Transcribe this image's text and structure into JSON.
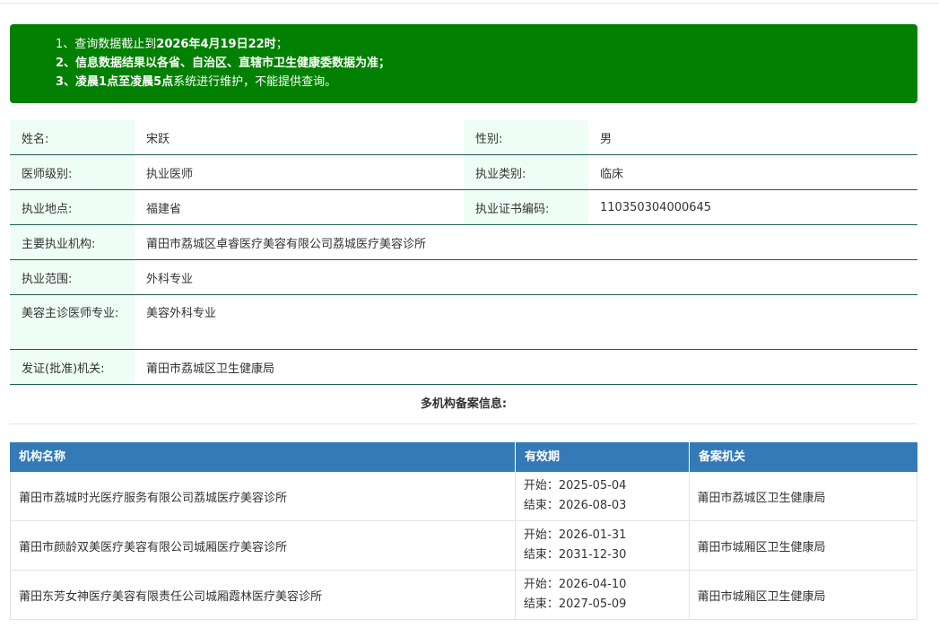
{
  "notice": {
    "line1_prefix": "1、查询数据截止到",
    "line1_bold": "2026年4月19日22时",
    "line1_suffix": "；",
    "line2": "2、信息数据结果以各省、自治区、直辖市卫生健康委数据为准；",
    "line3_prefix": "3、",
    "line3_bold": "凌晨1点至凌晨5点",
    "line3_suffix": "系统进行维护，不能提供查询。"
  },
  "info": {
    "name_label": "姓名:",
    "name_value": "宋跃",
    "gender_label": "性别:",
    "gender_value": "男",
    "level_label": "医师级别:",
    "level_value": "执业医师",
    "category_label": "执业类别:",
    "category_value": "临床",
    "location_label": "执业地点:",
    "location_value": "福建省",
    "cert_label": "执业证书编码:",
    "cert_value": "110350304000645",
    "org_label": "主要执业机构:",
    "org_value": "莆田市荔城区卓睿医疗美容有限公司荔城医疗美容诊所",
    "scope_label": "执业范围:",
    "scope_value": "外科专业",
    "cosmetic_label": "美容主诊医师专业:",
    "cosmetic_value": "美容外科专业",
    "issuer_label": "发证(批准)机关:",
    "issuer_value": "莆田市荔城区卫生健康局"
  },
  "multi_title": "多机构备案信息:",
  "table": {
    "headers": [
      "机构名称",
      "有效期",
      "备案机关"
    ],
    "rows": [
      {
        "name": "莆田市荔城时光医疗服务有限公司荔城医疗美容诊所",
        "start": "开始：2025-05-04",
        "end": "结束：2026-08-03",
        "authority": "莆田市荔城区卫生健康局"
      },
      {
        "name": "莆田市颜龄双美医疗美容有限公司城厢医疗美容诊所",
        "start": "开始：2026-01-31",
        "end": "结束：2031-12-30",
        "authority": "莆田市城厢区卫生健康局"
      },
      {
        "name": "莆田东芳女神医疗美容有限责任公司城厢霞林医疗美容诊所",
        "start": "开始：2026-04-10",
        "end": "结束：2027-05-09",
        "authority": "莆田市城厢区卫生健康局"
      }
    ]
  },
  "colors": {
    "notice_bg": "#018001",
    "label_bg": "#eefdf5",
    "row_border": "#1f5c54",
    "table_header_bg": "#337ab7"
  }
}
